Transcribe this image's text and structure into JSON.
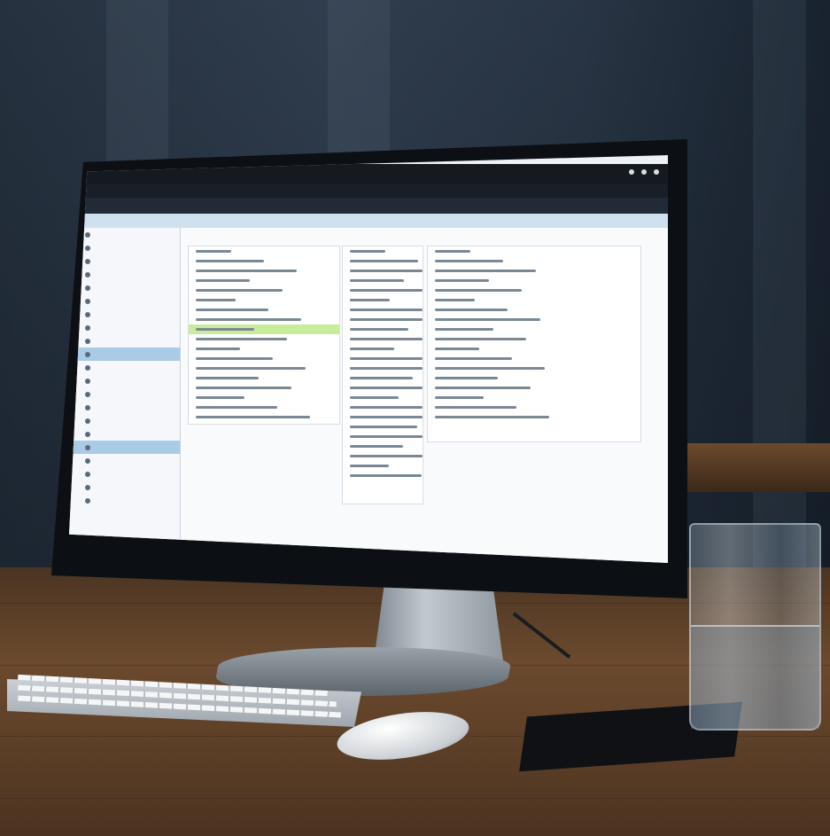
{
  "scene": {
    "description_items": [
      "monitor",
      "keyboard",
      "mouse",
      "glass-of-water",
      "desk",
      "window-background"
    ]
  },
  "screen": {
    "titlebar": [
      "",
      "",
      ""
    ],
    "menubar": [
      "",
      "",
      "",
      "",
      ""
    ],
    "toolbar": [
      "",
      "",
      "",
      ""
    ],
    "tabs": [
      "",
      "",
      ""
    ],
    "sidebar_items": [
      {
        "label": "",
        "active": false
      },
      {
        "label": "",
        "active": false
      },
      {
        "label": "",
        "active": false
      },
      {
        "label": "",
        "active": false
      },
      {
        "label": "",
        "active": false
      },
      {
        "label": "",
        "active": false
      },
      {
        "label": "",
        "active": false
      },
      {
        "label": "",
        "active": false
      },
      {
        "label": "",
        "active": false
      },
      {
        "label": "",
        "active": true
      },
      {
        "label": "",
        "active": false
      },
      {
        "label": "",
        "active": false
      },
      {
        "label": "",
        "active": false
      },
      {
        "label": "",
        "active": false
      },
      {
        "label": "",
        "active": false
      },
      {
        "label": "",
        "active": false
      },
      {
        "label": "",
        "active": true
      },
      {
        "label": "",
        "active": false
      },
      {
        "label": "",
        "active": false
      },
      {
        "label": "",
        "active": false
      },
      {
        "label": "",
        "active": false
      }
    ],
    "path": "",
    "left_panel_rows": 18,
    "mid_panel_rows": 24,
    "right_panel_rows": 18,
    "highlight_row_index": 8,
    "colors": {
      "highlight": "#c7ec9a",
      "selection": "#a9cbe6",
      "tabs": "#cfe0ef"
    }
  }
}
